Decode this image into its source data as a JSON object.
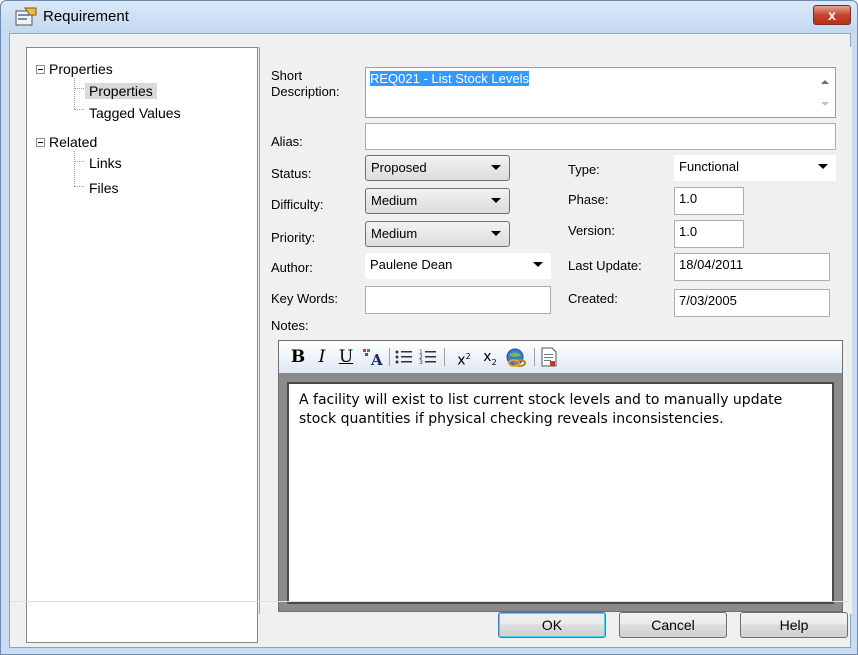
{
  "window": {
    "title": "Requirement",
    "close_label": "x"
  },
  "tree": {
    "nodes": [
      {
        "label": "Properties"
      },
      {
        "label": "Properties"
      },
      {
        "label": "Tagged Values"
      },
      {
        "label": "Related"
      },
      {
        "label": "Links"
      },
      {
        "label": "Files"
      }
    ]
  },
  "form": {
    "short_description_label": "Short\nDescription:",
    "short_description_value": "REQ021 - List Stock Levels",
    "alias_label": "Alias:",
    "alias_value": "",
    "status_label": "Status:",
    "status_value": "Proposed",
    "difficulty_label": "Difficulty:",
    "difficulty_value": "Medium",
    "priority_label": "Priority:",
    "priority_value": "Medium",
    "author_label": "Author:",
    "author_value": "Paulene Dean",
    "keywords_label": "Key Words:",
    "keywords_value": "",
    "type_label": "Type:",
    "type_value": "Functional",
    "phase_label": "Phase:",
    "phase_value": "1.0",
    "version_label": "Version:",
    "version_value": "1.0",
    "last_update_label": "Last Update:",
    "last_update_value": "18/04/2011",
    "created_label": "Created:",
    "created_value": "7/03/2005",
    "notes_label": "Notes:"
  },
  "toolbar": {
    "bold": "B",
    "italic": "I",
    "underline": "U",
    "superscript_x": "x",
    "superscript_2": "2",
    "subscript_x": "x",
    "subscript_2": "2"
  },
  "notes": {
    "text": "A facility will exist to list current stock levels and to manually update stock quantities if physical checking reveals inconsistencies."
  },
  "buttons": {
    "ok": "OK",
    "cancel": "Cancel",
    "help": "Help"
  },
  "colors": {
    "selection": "#3399ff",
    "close_button": "#c6452d",
    "titlebar": "#c9dcf2"
  }
}
